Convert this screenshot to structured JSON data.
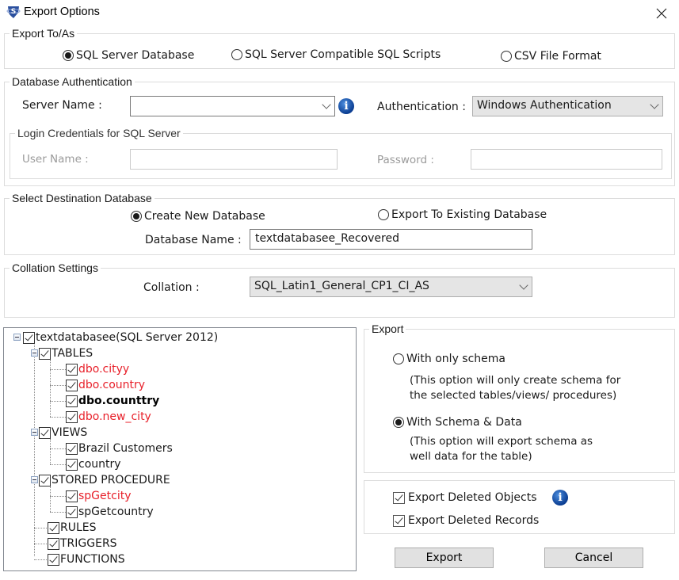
{
  "window": {
    "title": "Export Options",
    "icon": "app-shield-s-icon",
    "close_icon": "close-icon"
  },
  "export_to": {
    "legend": "Export To/As",
    "options": [
      {
        "label": "SQL Server Database",
        "selected": true
      },
      {
        "label": "SQL Server Compatible SQL Scripts",
        "selected": false
      },
      {
        "label": "CSV File Format",
        "selected": false
      }
    ]
  },
  "db_auth": {
    "legend": "Database Authentication",
    "server_name_label": "Server Name :",
    "server_name_value": "",
    "authentication_label": "Authentication :",
    "authentication_value": "Windows Authentication",
    "login": {
      "legend": "Login Credentials for SQL Server",
      "username_label": "User Name :",
      "username_value": "",
      "password_label": "Password :",
      "password_value": ""
    }
  },
  "destination": {
    "legend": "Select Destination Database",
    "options": [
      {
        "label": "Create New Database",
        "selected": true
      },
      {
        "label": "Export To Existing Database",
        "selected": false
      }
    ],
    "db_name_label": "Database Name :",
    "db_name_value": "textdatabasee_Recovered"
  },
  "collation": {
    "legend": "Collation Settings",
    "label": "Collation :",
    "value": "SQL_Latin1_General_CP1_CI_AS"
  },
  "tree": {
    "root": {
      "label": "textdatabasee(SQL Server 2012)",
      "checked": true,
      "expanded": true
    },
    "nodes": [
      {
        "label": "TABLES",
        "checked": true,
        "expanded": true,
        "children": [
          {
            "label": "dbo.cityy",
            "checked": true,
            "style": "deleted"
          },
          {
            "label": "dbo.country",
            "checked": true,
            "style": "deleted"
          },
          {
            "label": "dbo.counttry",
            "checked": true,
            "style": "bold"
          },
          {
            "label": "dbo.new_city",
            "checked": true,
            "style": "deleted"
          }
        ]
      },
      {
        "label": "VIEWS",
        "checked": true,
        "expanded": true,
        "children": [
          {
            "label": "Brazil Customers",
            "checked": true,
            "style": "normal"
          },
          {
            "label": "country",
            "checked": true,
            "style": "normal"
          }
        ]
      },
      {
        "label": "STORED PROCEDURE",
        "checked": true,
        "expanded": true,
        "children": [
          {
            "label": "spGetcity",
            "checked": true,
            "style": "deleted"
          },
          {
            "label": "spGetcountry",
            "checked": true,
            "style": "normal"
          }
        ]
      },
      {
        "label": "RULES",
        "checked": true
      },
      {
        "label": "TRIGGERS",
        "checked": true
      },
      {
        "label": "FUNCTIONS",
        "checked": true
      }
    ]
  },
  "export_mode": {
    "legend": "Export",
    "options": [
      {
        "label": "With only schema",
        "selected": false,
        "desc1": "(This option will only create schema for",
        "desc2": "the  selected tables/views/ procedures)"
      },
      {
        "label": "With Schema & Data",
        "selected": true,
        "desc1": "(This option will export schema as",
        "desc2": "well data for the table)"
      }
    ]
  },
  "deleted": {
    "objects_label": "Export Deleted Objects",
    "objects_checked": true,
    "records_label": "Export Deleted Records",
    "records_checked": true
  },
  "buttons": {
    "export": "Export",
    "cancel": "Cancel"
  },
  "colors": {
    "deleted_item": "#e8202a",
    "info_icon": "#0b3d91",
    "button_bg": "#e1e1e1",
    "combo_bg": "#e5e5e5"
  }
}
